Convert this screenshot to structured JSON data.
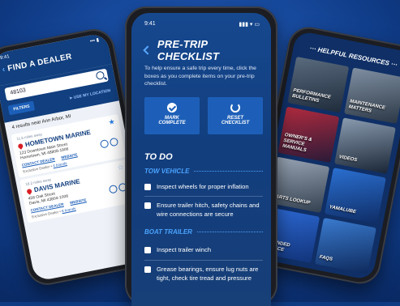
{
  "dealer_screen": {
    "time": "9:41",
    "signal": "••• ▮",
    "title": "FIND A DEALER",
    "search_value": "48103",
    "filters_label": "FILTERS",
    "use_location_label": "USE MY LOCATION",
    "results_text": "4 results near Ann Arbor, MI",
    "dealers": [
      {
        "distance": "11.6 miles away",
        "name": "HOMETOWN MARINE",
        "address_line1": "123 Downtown Main Street",
        "address_line2": "Hometown, MI 48808-1906",
        "contact_label": "CONTACT DEALER",
        "website_label": "WEBSITE",
        "exclusive_label": "Exclusive Dealer",
        "brands_label": "4 brands"
      },
      {
        "distance": "18.2 miles away",
        "name": "DAVIS MARINE",
        "address_line1": "456 Oak Street",
        "address_line2": "Davis, MI 43804-1006",
        "contact_label": "CONTACT DEALER",
        "website_label": "WEBSITE",
        "exclusive_label": "Exclusive Dealer",
        "brands_label": "6 brands"
      }
    ]
  },
  "checklist_screen": {
    "time": "9:41",
    "status_icons": "▮▮▮ ▾ ▭",
    "title": "PRE-TRIP CHECKLIST",
    "intro": "To help ensure a safe trip every time, click the boxes as you complete items on your pre-trip checklist.",
    "mark_complete": [
      "MARK",
      "COMPLETE"
    ],
    "reset_checklist": [
      "RESET",
      "CHECKLIST"
    ],
    "todo_heading": "TO DO",
    "sections": [
      {
        "title": "TOW VEHICLE",
        "items": [
          "Inspect wheels for proper inflation",
          "Ensure trailer hitch, safety chains and wire connections are secure"
        ]
      },
      {
        "title": "BOAT TRAILER",
        "items": [
          "Inspect trailer winch",
          "Grease bearings, ensure lug nuts are tight, check tire tread and pressure"
        ]
      }
    ]
  },
  "resources_screen": {
    "title": "HELPFUL RESOURCES",
    "tiles": [
      {
        "label": [
          "PERFORMANCE",
          "BULLETINS"
        ],
        "color_a": "#5a6b7e",
        "color_b": "#1f2c3c"
      },
      {
        "label": [
          "MAINTENANCE",
          "MATTERS"
        ],
        "color_a": "#7f8fa2",
        "color_b": "#2c3846"
      },
      {
        "label": [
          "OWNER'S &",
          "SERVICE",
          "MANUALS"
        ],
        "color_a": "#b02a3e",
        "color_b": "#2a1a38"
      },
      {
        "label": [
          "VIDEOS"
        ],
        "color_a": "#8a9bb0",
        "color_b": "#1a2636"
      },
      {
        "label": [
          "PARTS LOOKUP"
        ],
        "color_a": "#9aa6b6",
        "color_b": "#33404f"
      },
      {
        "label": [
          "YAMALUBE"
        ],
        "color_a": "#2a6fd0",
        "color_b": "#0f2d66"
      },
      {
        "label": [
          "EXTENDED",
          "SERVICE"
        ],
        "color_a": "#2d6ad6",
        "color_b": "#12347a"
      },
      {
        "label": [
          "FAQS"
        ],
        "color_a": "#3a7bcf",
        "color_b": "#0e2a5c"
      }
    ]
  }
}
